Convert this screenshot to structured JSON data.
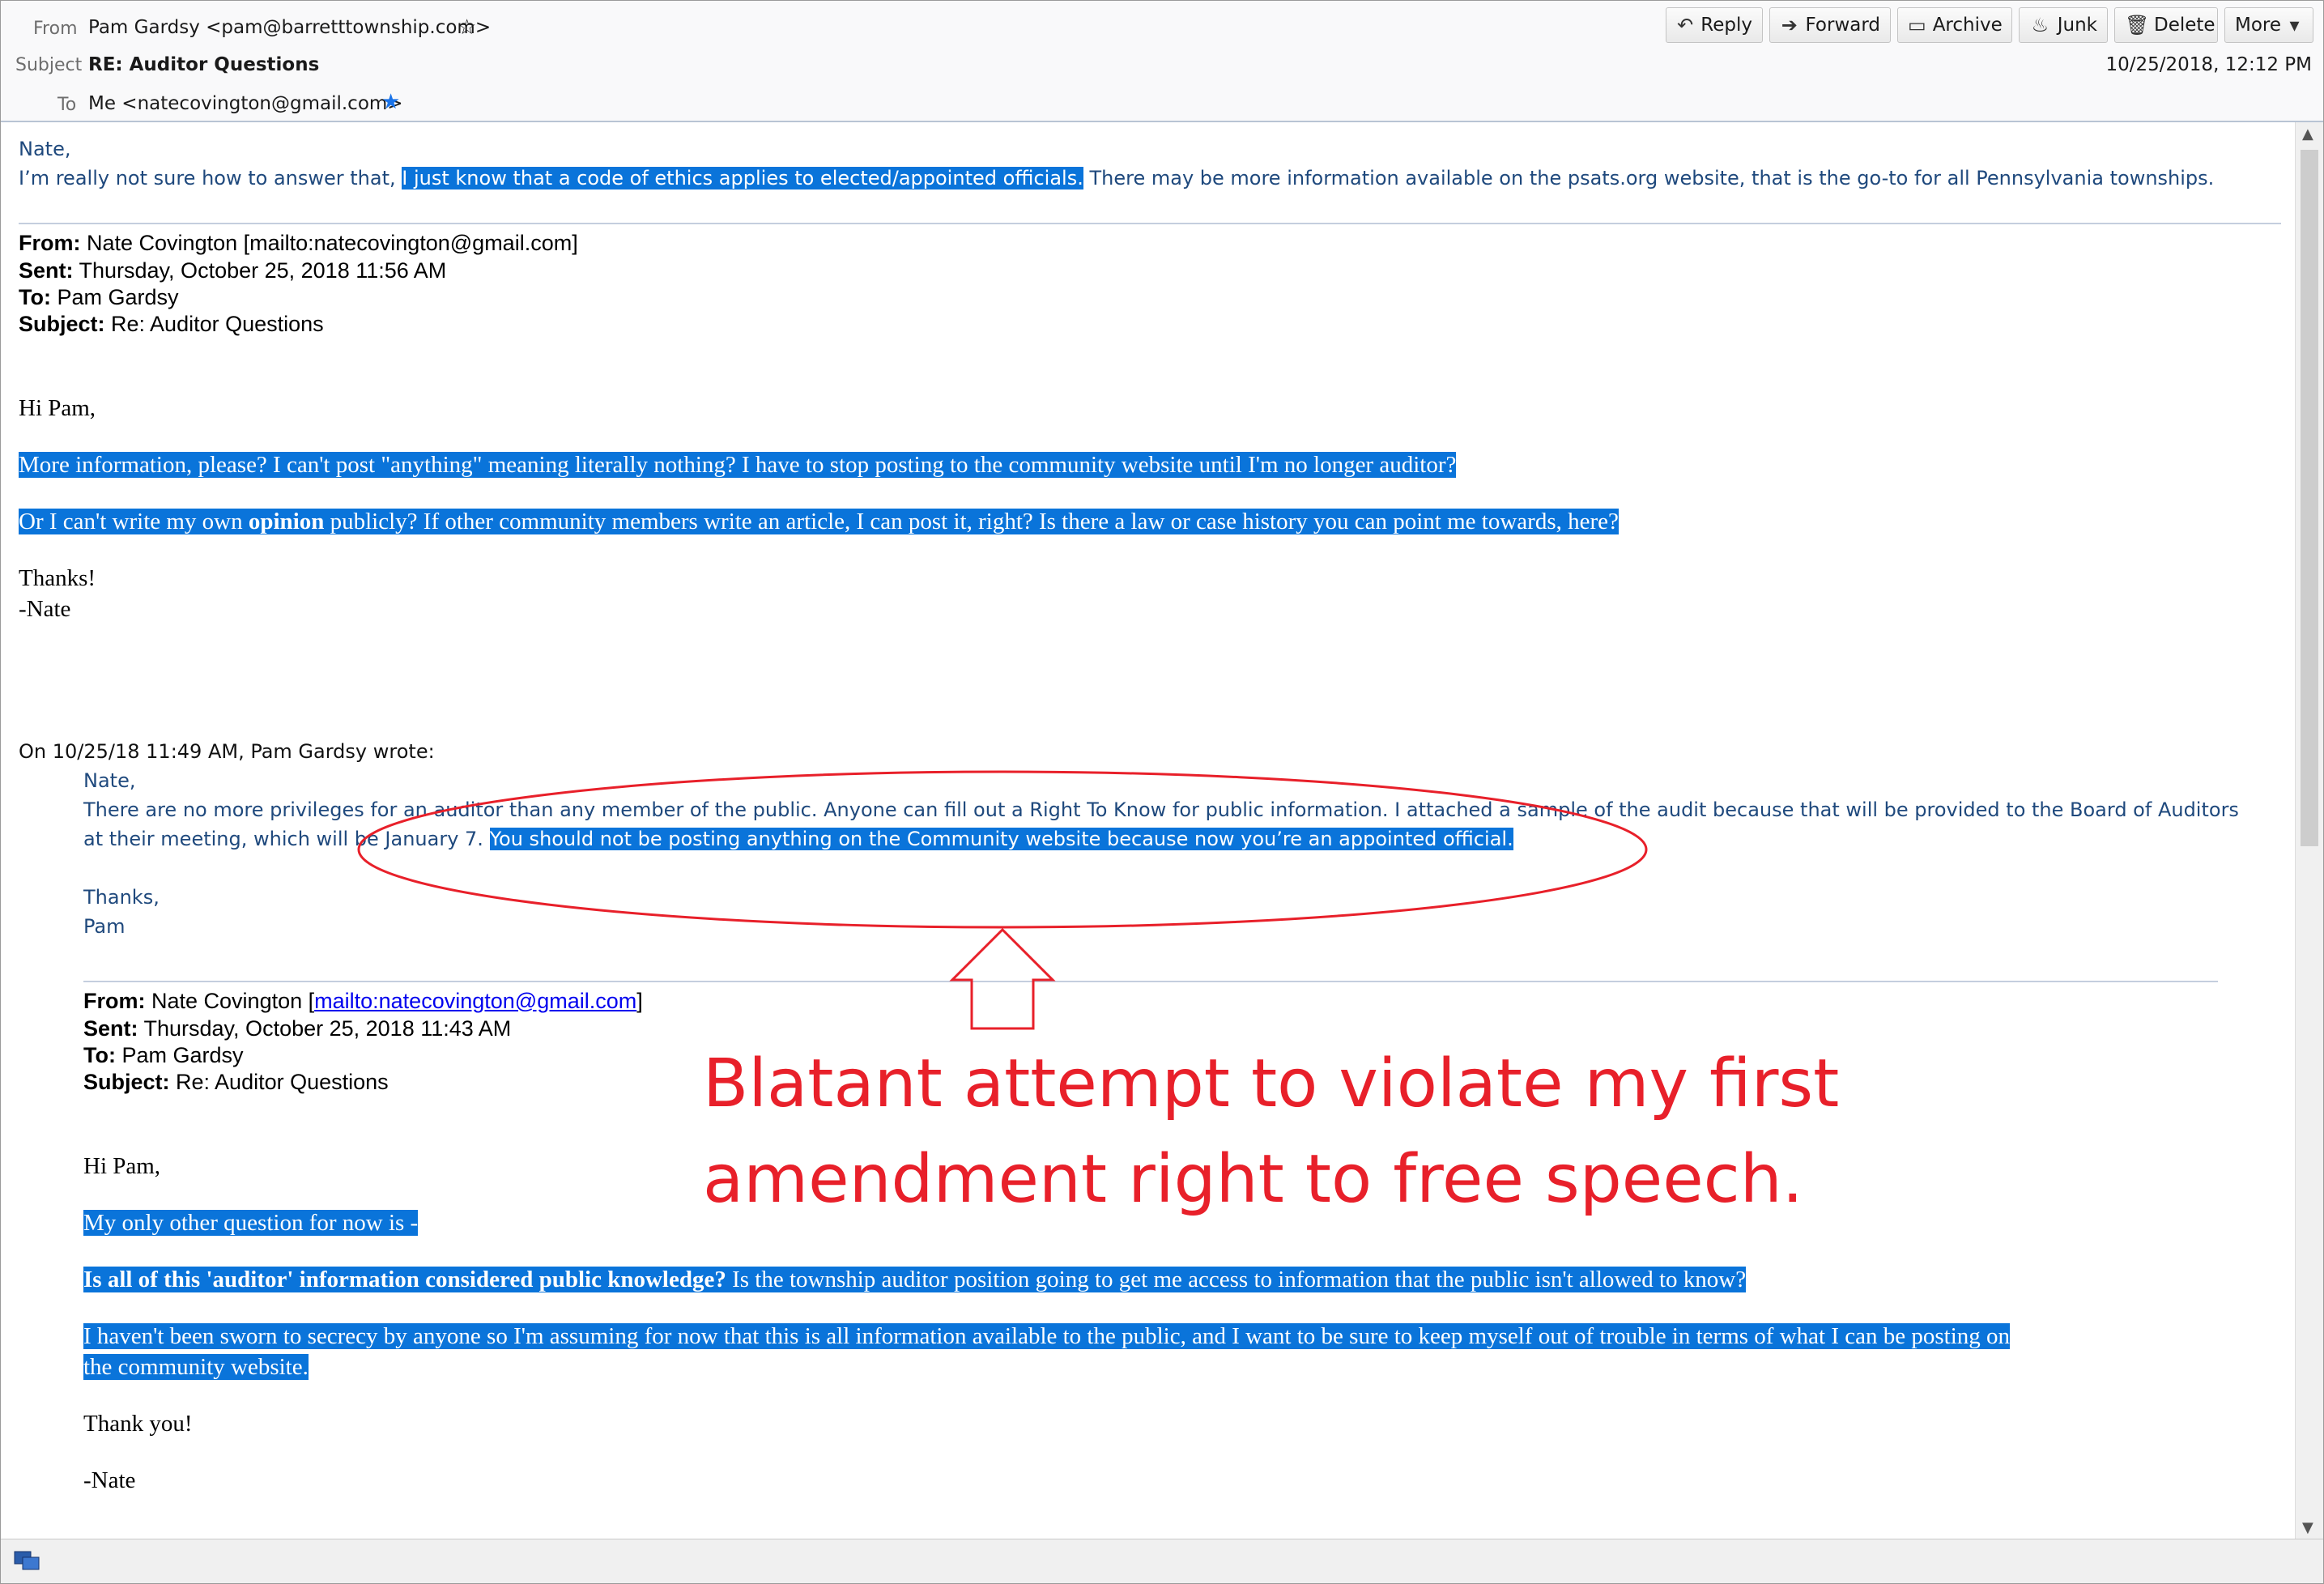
{
  "header": {
    "from_label": "From",
    "from_value": "Pam Gardsy <pam@barretttownship.com>",
    "subject_label": "Subject",
    "subject_value": "RE: Auditor Questions",
    "to_label": "To",
    "to_value": "Me <natecovington@gmail.com>",
    "date": "10/25/2018, 12:12 PM"
  },
  "toolbar": {
    "reply": "Reply",
    "forward": "Forward",
    "archive": "Archive",
    "junk": "Junk",
    "delete": "Delete",
    "more": "More"
  },
  "reply": {
    "greeting": "Nate,",
    "pre": "I’m really not sure how to answer that, ",
    "highlight": "I just know that a code of ethics applies to elected/appointed officials.",
    "post": " There may be more information available on the psats.org website, that is the go-to for all Pennsylvania townships."
  },
  "quote1": {
    "from_label": "From:",
    "from_value": " Nate Covington [mailto:natecovington@gmail.com]",
    "sent_label": "Sent:",
    "sent_value": " Thursday, October 25, 2018 11:56 AM",
    "to_label": "To:",
    "to_value": " Pam Gardsy",
    "subject_label": "Subject:",
    "subject_value": " Re: Auditor Questions",
    "greeting": "Hi Pam,",
    "p1": "More information, please?  I can't post \"anything\" meaning literally nothing?  I have to stop posting to the community website until I'm no longer auditor?",
    "p2_pre": "Or I can't write my own ",
    "p2_bold": "opinion",
    "p2_post": " publicly?  If other community members write an article, I can post it, right?  Is there a law or case history you can point me towards, here?  ",
    "thanks": "Thanks!",
    "sign": "-Nate"
  },
  "wrote": "On 10/25/18 11:49 AM, Pam Gardsy wrote:",
  "quote2": {
    "greeting": "Nate,",
    "line1": "There are no more privileges for an auditor than any member of the public. Anyone can fill out a Right To Know for public information. I attached a sample of the audit because that will be provided to the Board of Auditors",
    "line2_pre": "at their meeting, which will be January 7. ",
    "line2_highlight": "You should not be posting anything on the Community website because now you’re an appointed official.",
    "thanks": "Thanks,",
    "sign": "Pam"
  },
  "quote3": {
    "from_label": "From:",
    "from_name": " Nate Covington [",
    "from_link": "mailto:natecovington@gmail.com",
    "from_close": "]",
    "sent_label": "Sent:",
    "sent_value": " Thursday, October 25, 2018 11:43 AM",
    "to_label": "To:",
    "to_value": " Pam Gardsy",
    "subject_label": "Subject:",
    "subject_value": " Re: Auditor Questions",
    "greeting": "Hi Pam,",
    "p1": "My only other question for now is - ",
    "p2_bold": "Is all of this 'auditor' information considered public knowledge?",
    "p2_post": "  Is the township auditor position going to get me access to information that the public isn't allowed to know?  ",
    "p3_line1": "I haven't been sworn to secrecy by anyone so I'm assuming for now that this is all information available to the public, and I want to be sure to keep myself out of trouble in terms of what I can be posting on",
    "p3_line2": "the community website.  ",
    "thanks": "Thank you!",
    "sign": "-Nate"
  },
  "annotation": {
    "line1": "Blatant attempt to violate my first",
    "line2": "amendment right to free speech.",
    "color": "#e8202a"
  },
  "colors": {
    "selection": "#0a74da",
    "quote_text": "#1f497d"
  }
}
